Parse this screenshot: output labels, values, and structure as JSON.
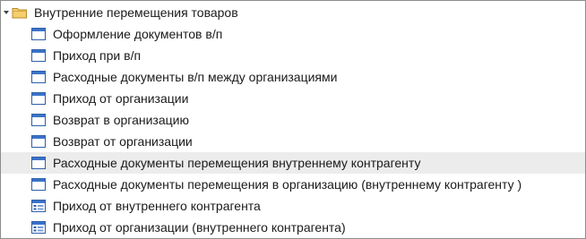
{
  "tree": {
    "root": {
      "label": "Внутренние перемещения товаров",
      "icon": "folder-icon",
      "expanded": true
    },
    "items": [
      {
        "label": "Оформление документов в/п",
        "icon": "form-icon"
      },
      {
        "label": "Приход при в/п",
        "icon": "form-icon"
      },
      {
        "label": "Расходные документы в/п между организациями",
        "icon": "form-icon"
      },
      {
        "label": "Приход от организации",
        "icon": "form-icon"
      },
      {
        "label": "Возврат в организацию",
        "icon": "form-icon"
      },
      {
        "label": "Возврат от организации",
        "icon": "form-icon"
      },
      {
        "label": "Расходные документы перемещения внутреннему контрагенту",
        "icon": "form-icon",
        "selected": true
      },
      {
        "label": "Расходные документы перемещения в организацию (внутреннему контрагенту )",
        "icon": "form-icon"
      },
      {
        "label": "Приход от внутреннего контрагента",
        "icon": "list-form-icon"
      },
      {
        "label": "Приход от организации (внутреннего контрагента)",
        "icon": "list-form-icon"
      }
    ]
  },
  "colors": {
    "selected_row": "#ececec",
    "folder": "#e8b84a",
    "form_icon_border": "#2f5fa8",
    "form_icon_title": "#3b73c8"
  }
}
